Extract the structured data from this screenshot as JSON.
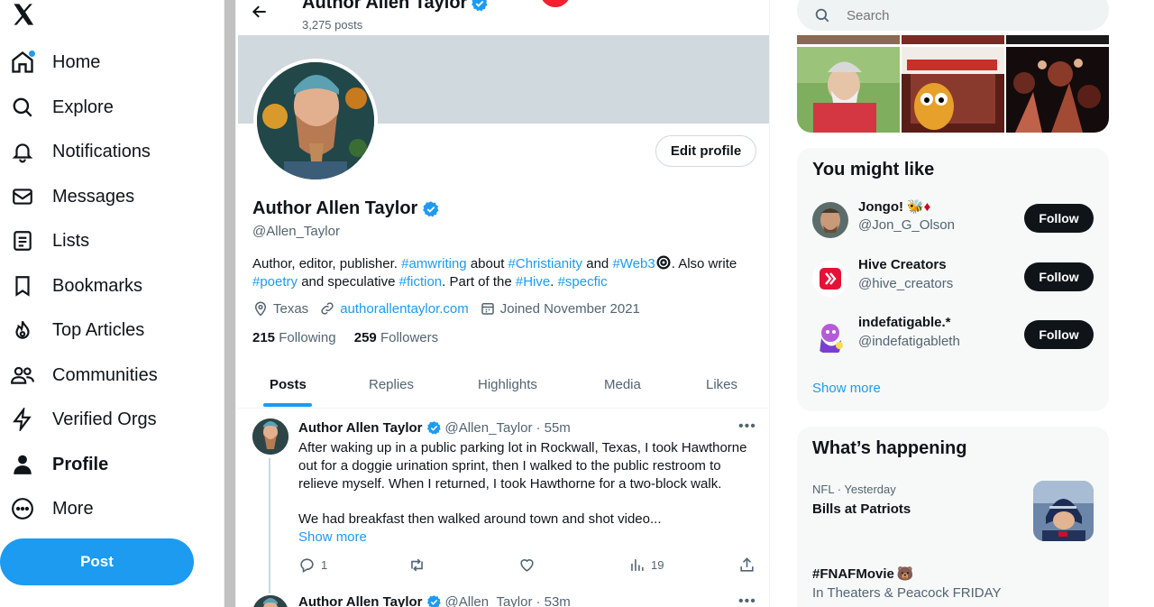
{
  "nav": {
    "items": [
      {
        "label": "Home",
        "icon": "home-icon"
      },
      {
        "label": "Explore",
        "icon": "search-icon"
      },
      {
        "label": "Notifications",
        "icon": "bell-icon"
      },
      {
        "label": "Messages",
        "icon": "envelope-icon"
      },
      {
        "label": "Lists",
        "icon": "list-icon"
      },
      {
        "label": "Bookmarks",
        "icon": "bookmark-icon"
      },
      {
        "label": "Top Articles",
        "icon": "flame-icon"
      },
      {
        "label": "Communities",
        "icon": "people-icon"
      },
      {
        "label": "Verified Orgs",
        "icon": "lightning-icon"
      },
      {
        "label": "Profile",
        "icon": "person-icon"
      },
      {
        "label": "More",
        "icon": "more-circle-icon"
      }
    ],
    "post_label": "Post"
  },
  "header": {
    "name": "Author Allen Taylor",
    "post_count": "3,275 posts"
  },
  "profile": {
    "edit_label": "Edit profile",
    "name": "Author Allen Taylor",
    "handle": "@Allen_Taylor",
    "bio": {
      "p1": "Author, editor, publisher. ",
      "h1": "#amwriting",
      "p2": " about ",
      "h2": "#Christianity",
      "p3": " and ",
      "h3": "#Web3",
      "p4": ". Also write ",
      "h4": "#poetry",
      "p5": " and speculative ",
      "h5": "#fiction",
      "p6": ". Part of the ",
      "h6": "#Hive",
      "p7": ". ",
      "h7": "#specfic"
    },
    "location": "Texas",
    "website": "authorallentaylor.com",
    "joined": "Joined November 2021",
    "following_count": "215",
    "following_label": "Following",
    "followers_count": "259",
    "followers_label": "Followers"
  },
  "tabs": [
    "Posts",
    "Replies",
    "Highlights",
    "Media",
    "Likes"
  ],
  "tweets": [
    {
      "name": "Author Allen Taylor",
      "handle": "@Allen_Taylor",
      "time": "· 55m",
      "text1": "After waking up in a public parking lot in Rockwall, Texas, I took Hawthorne out for a doggie urination sprint, then I walked to the public restroom to relieve myself. When I returned, I took Hawthorne for a two-block walk.",
      "text2": "We had breakfast then walked around town and shot video...",
      "show_more": "Show more",
      "replies": "1",
      "views": "19"
    },
    {
      "name": "Author Allen Taylor",
      "handle": "@Allen_Taylor",
      "time": "· 53m"
    }
  ],
  "search": {
    "placeholder": "Search"
  },
  "you_might_like": {
    "title": "You might like",
    "users": [
      {
        "name": "Jongo!",
        "emoji": "🐝♦",
        "handle": "@Jon_G_Olson",
        "follow": "Follow"
      },
      {
        "name": "Hive Creators",
        "emoji": "",
        "handle": "@hive_creators",
        "follow": "Follow"
      },
      {
        "name": "indefatigable.*",
        "emoji": "",
        "handle": "@indefatigableth",
        "follow": "Follow"
      }
    ],
    "show_more": "Show more"
  },
  "whats_happening": {
    "title": "What’s happening",
    "trends": [
      {
        "meta": "NFL · Yesterday",
        "name": "Bills at Patriots"
      },
      {
        "name": "#FNAFMovie",
        "emoji": "🐻",
        "sub": "In Theaters & Peacock FRIDAY"
      }
    ]
  },
  "colors": {
    "accent": "#1d9bf0",
    "text": "#0f1419",
    "muted": "#536471",
    "banner": "#cfd9de"
  }
}
